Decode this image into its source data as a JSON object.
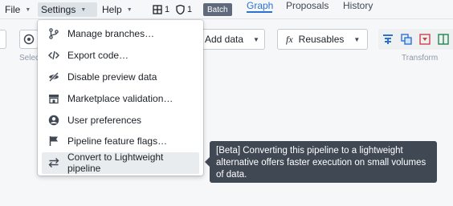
{
  "menubar": {
    "file": "File",
    "settings": "Settings",
    "help": "Help",
    "branch_count": "1",
    "shield_count": "1",
    "batch_badge": "Batch"
  },
  "tabs": [
    {
      "label": "Graph",
      "selected": true
    },
    {
      "label": "Proposals",
      "selected": false
    },
    {
      "label": "History",
      "selected": false
    }
  ],
  "toolbar": {
    "select_label": "Selec",
    "add_data": "Add data",
    "reusables": "Reusables",
    "reusables_prefix": "fx",
    "transform_label": "Transform"
  },
  "settings_menu": {
    "items": [
      {
        "label": "Manage branches…",
        "icon": "git-branch-icon"
      },
      {
        "label": "Export code…",
        "icon": "code-icon"
      },
      {
        "label": "Disable preview data",
        "icon": "eye-off-icon"
      },
      {
        "label": "Marketplace validation…",
        "icon": "shop-icon"
      },
      {
        "label": "User preferences",
        "icon": "user-icon"
      },
      {
        "label": "Pipeline feature flags…",
        "icon": "flag-icon"
      },
      {
        "label": "Convert to Lightweight pipeline",
        "icon": "swap-icon"
      }
    ],
    "hovered_index": 6
  },
  "tooltip": {
    "text": "[Beta] Converting this pipeline to a lightweight alternative offers faster execution on small volumes of data."
  },
  "colors": {
    "accent": "#2d72d2",
    "badge": "#5f6b7c",
    "tooltip_bg": "#404854"
  }
}
